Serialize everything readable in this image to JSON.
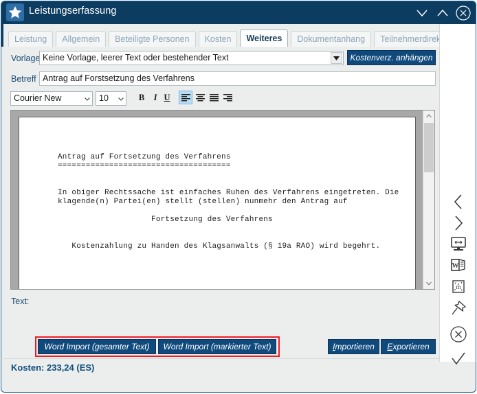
{
  "window": {
    "title": "Leistungserfassung",
    "app_icon": "star-icon",
    "controls": [
      {
        "name": "minimize-button",
        "icon": "chevron-down-icon"
      },
      {
        "name": "restore-button",
        "icon": "chevron-up-icon"
      },
      {
        "name": "close-button",
        "icon": "circle-close-icon"
      }
    ],
    "colors": {
      "titlebar": "#0d3c61",
      "accent_button": "#104a7d",
      "highlight_box": "#ee1c25",
      "label_text": "#1a4a73",
      "status_text": "#12507f",
      "active_toolbutton": "#b9dcf5"
    }
  },
  "tabs": [
    {
      "label": "Leistung",
      "active": false
    },
    {
      "label": "Allgemein",
      "active": false
    },
    {
      "label": "Beteiligte Personen",
      "active": false
    },
    {
      "label": "Kosten",
      "active": false
    },
    {
      "label": "Weiteres",
      "active": true
    },
    {
      "label": "Dokumentanhang",
      "active": false
    },
    {
      "label": "Teilnehmerdirektzustellung",
      "active": false
    }
  ],
  "form": {
    "vorlage_label": "Vorlage",
    "vorlage_value": "Keine Vorlage, leerer Text oder bestehender Text",
    "kostenverz_button": "Kostenverz. anhängen",
    "betreff_label": "Betreff",
    "betreff_value": "Antrag auf Forstsetzung des Verfahrens",
    "text_label": "Text:"
  },
  "format_toolbar": {
    "font_name": "Courier New",
    "font_size": "10",
    "bold": "B",
    "italic": "I",
    "underline": "U",
    "align_buttons": [
      {
        "name": "align-left-button",
        "active": true
      },
      {
        "name": "align-center-button",
        "active": false
      },
      {
        "name": "align-justify-button",
        "active": false
      },
      {
        "name": "align-right-button",
        "active": false
      }
    ]
  },
  "document": {
    "content": "Antrag auf Fortsetzung des Verfahrens\n=====================================\n\n\nIn obiger Rechtssache ist einfaches Ruhen des Verfahrens eingetreten. Die\nklagende(n) Partei(en) stellt (stellen) nunmehr den Antrag auf\n\n                    Fortsetzung des Verfahrens\n\n\n   Kostenzahlung zu Handen des Klagsanwalts (§ 19a RAO) wird begehrt."
  },
  "bottom_buttons": {
    "word_import_all": "Word Import (gesamter Text)",
    "word_import_selected": "Word Import (markierter Text)",
    "importieren_acc": "I",
    "importieren_rest": "mportieren",
    "exportieren_acc": "E",
    "exportieren_rest": "xportieren"
  },
  "status": {
    "kosten": "Kosten: 233,24 (ES)"
  },
  "sidebar": {
    "items": [
      {
        "name": "previous-button",
        "icon": "chevron-left-icon"
      },
      {
        "name": "next-button",
        "icon": "chevron-right-icon"
      },
      {
        "name": "resize-window-button",
        "icon": "monitor-resize-icon"
      },
      {
        "name": "word-export-button",
        "icon": "word-document-icon"
      },
      {
        "name": "macro-button",
        "icon": "macro-m-icon"
      },
      {
        "name": "pin-button",
        "icon": "pushpin-icon"
      },
      {
        "name": "cancel-button",
        "icon": "circle-close-icon"
      },
      {
        "name": "confirm-button",
        "icon": "checkmark-icon"
      }
    ]
  }
}
